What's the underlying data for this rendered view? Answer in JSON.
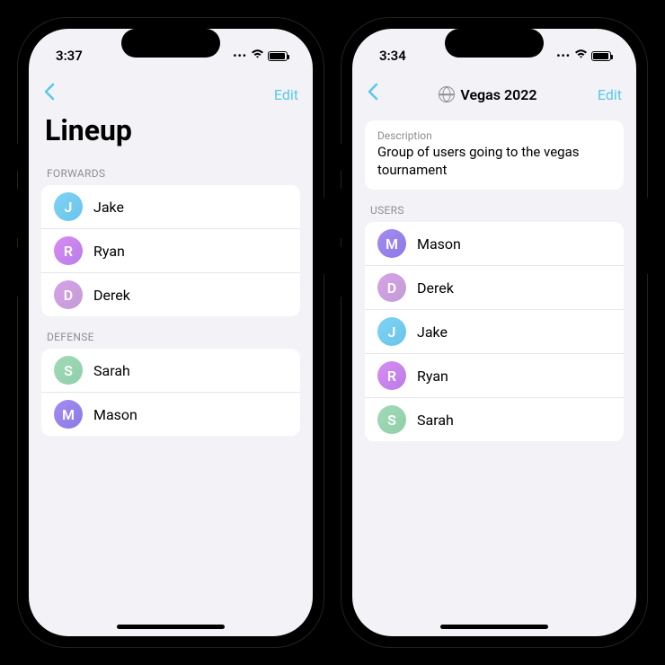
{
  "phone_left": {
    "time": "3:37",
    "nav": {
      "edit": "Edit"
    },
    "title": "Lineup",
    "sections": [
      {
        "header": "FORWARDS",
        "rows": [
          {
            "initial": "J",
            "name": "Jake",
            "color1": "#7dd3f5",
            "color2": "#6bc4e8"
          },
          {
            "initial": "R",
            "name": "Ryan",
            "color1": "#d98cf2",
            "color2": "#b77de8"
          },
          {
            "initial": "D",
            "name": "Derek",
            "color1": "#d6a3e8",
            "color2": "#c39bd6"
          }
        ]
      },
      {
        "header": "DEFENSE",
        "rows": [
          {
            "initial": "S",
            "name": "Sarah",
            "color1": "#a3d9b8",
            "color2": "#8ecfa9"
          },
          {
            "initial": "M",
            "name": "Mason",
            "color1": "#a58cf0",
            "color2": "#8a7ae6"
          }
        ]
      }
    ]
  },
  "phone_right": {
    "time": "3:34",
    "nav": {
      "edit": "Edit",
      "title": "Vegas 2022"
    },
    "description": {
      "label": "Description",
      "text": "Group of users going to the vegas tournament"
    },
    "section_header": "USERS",
    "rows": [
      {
        "initial": "M",
        "name": "Mason",
        "color1": "#a58cf0",
        "color2": "#8a7ae6"
      },
      {
        "initial": "D",
        "name": "Derek",
        "color1": "#d6a3e8",
        "color2": "#c39bd6"
      },
      {
        "initial": "J",
        "name": "Jake",
        "color1": "#7dd3f5",
        "color2": "#6bc4e8"
      },
      {
        "initial": "R",
        "name": "Ryan",
        "color1": "#d98cf2",
        "color2": "#b77de8"
      },
      {
        "initial": "S",
        "name": "Sarah",
        "color1": "#a3d9b8",
        "color2": "#8ecfa9"
      }
    ]
  }
}
